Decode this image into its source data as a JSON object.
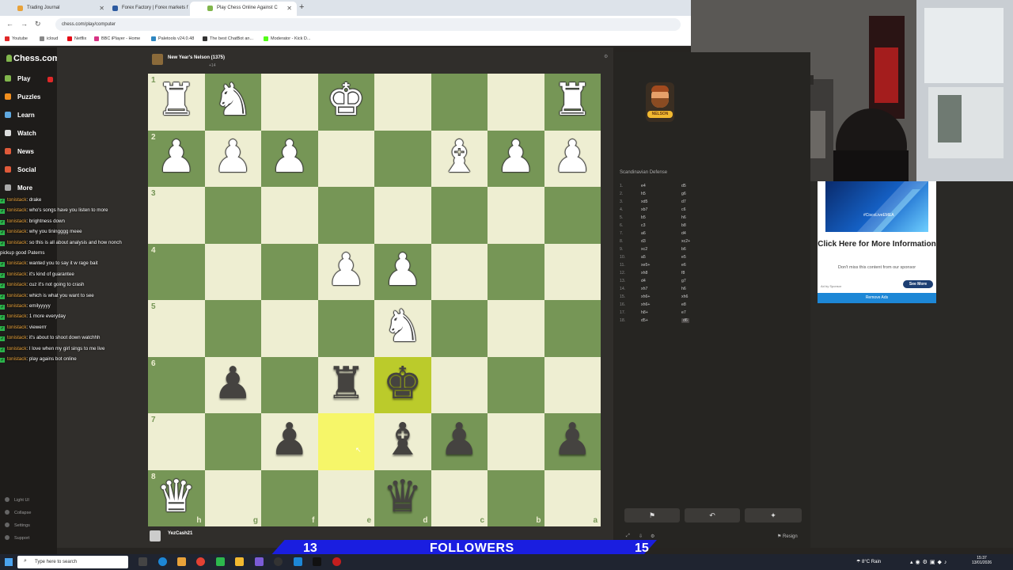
{
  "browser": {
    "tabs": [
      {
        "label": "Trading Journal",
        "color": "#e8a23a"
      },
      {
        "label": "Forex Factory | Forex markets f",
        "color": "#2c5aa0"
      },
      {
        "label": "Play Chess Online Against C",
        "color": "#81b64c"
      }
    ],
    "url": "chess.com/play/computer",
    "bookmarks": [
      {
        "label": "Youtube",
        "color": "#e02828"
      },
      {
        "label": "icloud",
        "color": "#888888"
      },
      {
        "label": "Netflix",
        "color": "#e50914"
      },
      {
        "label": "BBC iPlayer - Home",
        "color": "#d63384"
      },
      {
        "label": "Paletools v24.0.48",
        "color": "#2e86c1"
      },
      {
        "label": "The best ChatBot an...",
        "color": "#333333"
      },
      {
        "label": "Moderator - Kick D...",
        "color": "#53fc18"
      }
    ]
  },
  "sidebar": {
    "logo": "Chess.com",
    "items": [
      {
        "label": "Play",
        "color": "#81b64c"
      },
      {
        "label": "Puzzles",
        "color": "#f28f1e"
      },
      {
        "label": "Learn",
        "color": "#5fa8e0"
      },
      {
        "label": "Watch",
        "color": "#ddd"
      },
      {
        "label": "News",
        "color": "#e05a3a"
      },
      {
        "label": "Social",
        "color": "#e05a3a"
      },
      {
        "label": "More",
        "color": "#aaa"
      }
    ],
    "bottom": [
      "Light UI",
      "Collapse",
      "Settings",
      "Support"
    ]
  },
  "chat": [
    {
      "user": "tonistack",
      "msg": ": drake"
    },
    {
      "user": "tonistack",
      "msg": ": who's songs have you listen to more"
    },
    {
      "user": "tonistack",
      "msg": ": brightness down"
    },
    {
      "user": "tonistack",
      "msg": ": why you tiningggg meee"
    },
    {
      "user": "tonistack",
      "msg": ": so this is all about analysis and how nonch"
    },
    {
      "user": "",
      "msg": "pickup good Paterns"
    },
    {
      "user": "tonistack",
      "msg": ": wanted you to say it w rage bait"
    },
    {
      "user": "tonistack",
      "msg": ": it's kind of guarantee"
    },
    {
      "user": "tonistack",
      "msg": ": cuz it's not going to crash"
    },
    {
      "user": "tonistack",
      "msg": ": which is what you want to see"
    },
    {
      "user": "tonistack",
      "msg": ": emilyyyyy"
    },
    {
      "user": "tonistack",
      "msg": ": 1 more everyday"
    },
    {
      "user": "tonistack",
      "msg": ": viewerrr"
    },
    {
      "user": "tonistack",
      "msg": ": it's about to shoot down watchhh"
    },
    {
      "user": "tonistack",
      "msg": ": I love when my girl sings to me live"
    },
    {
      "user": "tonistack",
      "msg": ": play agains bot online"
    }
  ],
  "opponent": {
    "name": "New Year's Nelson (1375)",
    "material": "+14"
  },
  "player": {
    "name": "YezCash21"
  },
  "board": {
    "ranks": [
      "1",
      "2",
      "3",
      "4",
      "5",
      "6",
      "7",
      "8"
    ],
    "files": [
      "h",
      "g",
      "f",
      "e",
      "d",
      "c",
      "b",
      "a"
    ],
    "pieces": [
      "R N . K . . . R",
      "P P P . . B P P",
      ". . . . . . . .",
      ". . . P P . . .",
      ". . . . N . . .",
      ". p . r k . . .",
      ". . p . b p . p",
      "Q . . . q . . ."
    ],
    "highlights": [
      {
        "r": 5,
        "c": 4,
        "kind": "hl"
      },
      {
        "r": 6,
        "c": 3,
        "kind": "hll"
      }
    ],
    "glyphs": {
      "K": "♚",
      "Q": "♛",
      "R": "♜",
      "B": "♝",
      "N": "♞",
      "P": "♟"
    }
  },
  "opening": "Scandinavian Defense",
  "moves": [
    {
      "n": "1.",
      "w": "e4",
      "b": "d5"
    },
    {
      "n": "2.",
      "w": "h5",
      "b": "g6"
    },
    {
      "n": "3.",
      "w": "xd5",
      "b": "d7"
    },
    {
      "n": "4.",
      "w": "xb7",
      "b": "c6"
    },
    {
      "n": "5.",
      "w": "b5",
      "b": "h6"
    },
    {
      "n": "6.",
      "w": "c3",
      "b": "b8"
    },
    {
      "n": "7.",
      "w": "a6",
      "b": "d4"
    },
    {
      "n": "8.",
      "w": "d3",
      "b": "xc2+"
    },
    {
      "n": "9.",
      "w": "xc2",
      "b": "b6"
    },
    {
      "n": "10.",
      "w": "a5",
      "b": "e5"
    },
    {
      "n": "11.",
      "w": "xe5+",
      "b": "e6"
    },
    {
      "n": "12.",
      "w": "xh8",
      "b": "f8"
    },
    {
      "n": "13.",
      "w": "d4",
      "b": "g7"
    },
    {
      "n": "14.",
      "w": "xh7",
      "b": "h6"
    },
    {
      "n": "15.",
      "w": "xh6+",
      "b": "xh6"
    },
    {
      "n": "16.",
      "w": "xh6+",
      "b": "e8"
    },
    {
      "n": "17.",
      "w": "h8+",
      "b": "e7"
    },
    {
      "n": "18.",
      "w": "d5+",
      "b": "d6"
    }
  ],
  "bot_name": "NELSON",
  "resign": "Resign",
  "ad": {
    "tag": "#CiscoLiveEMEA",
    "title": "Click Here for More Information",
    "sub": "Don't miss this content from our sponsor",
    "small": "Ad by Sponsor",
    "button": "See More",
    "remove": "Remove Ads"
  },
  "overlay": {
    "left": "13",
    "label": "FOLLOWERS",
    "right": "15"
  },
  "taskbar": {
    "search": "Type here to search",
    "weather": "8°C  Rain",
    "time": "15:37",
    "date": "13/01/2026"
  }
}
